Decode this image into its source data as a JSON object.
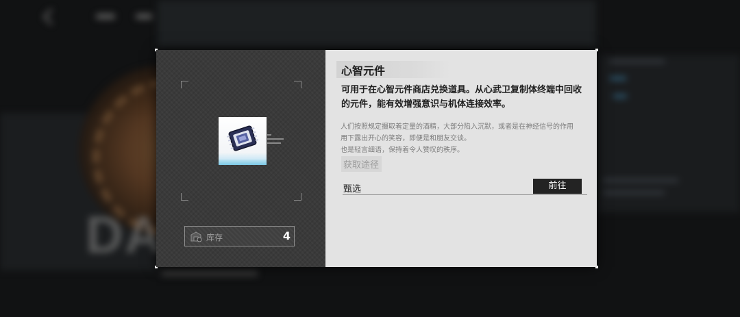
{
  "item": {
    "title": "心智元件",
    "description": "可用于在心智元件商店兑换道具。从心武卫复制体终端中回收的元件，能有效增强意识与机体连接效率。",
    "flavor_lines": [
      "人们按照规定摄取着定量的酒精，大部分陷入沉默，或者是在神经信号的作用",
      "用下露出开心的笑容，即便是和朋友交谈。",
      "也是轻言细语，保持着令人赞叹的秩序。"
    ]
  },
  "stock": {
    "label": "库存",
    "count": "4"
  },
  "source": {
    "heading": "获取途径",
    "items": [
      {
        "name": "甄选",
        "action_label": "前往"
      }
    ]
  },
  "background": {
    "big_text": "DA"
  },
  "colors": {
    "modal_right_bg": "#e3e3e3",
    "modal_left_bg": "#3a3a3a",
    "button_bg": "#232323",
    "card_accent": "#7cc8e6"
  },
  "icons": {
    "item_icon": "chip-icon",
    "stock_icon": "warehouse-box-icon"
  }
}
